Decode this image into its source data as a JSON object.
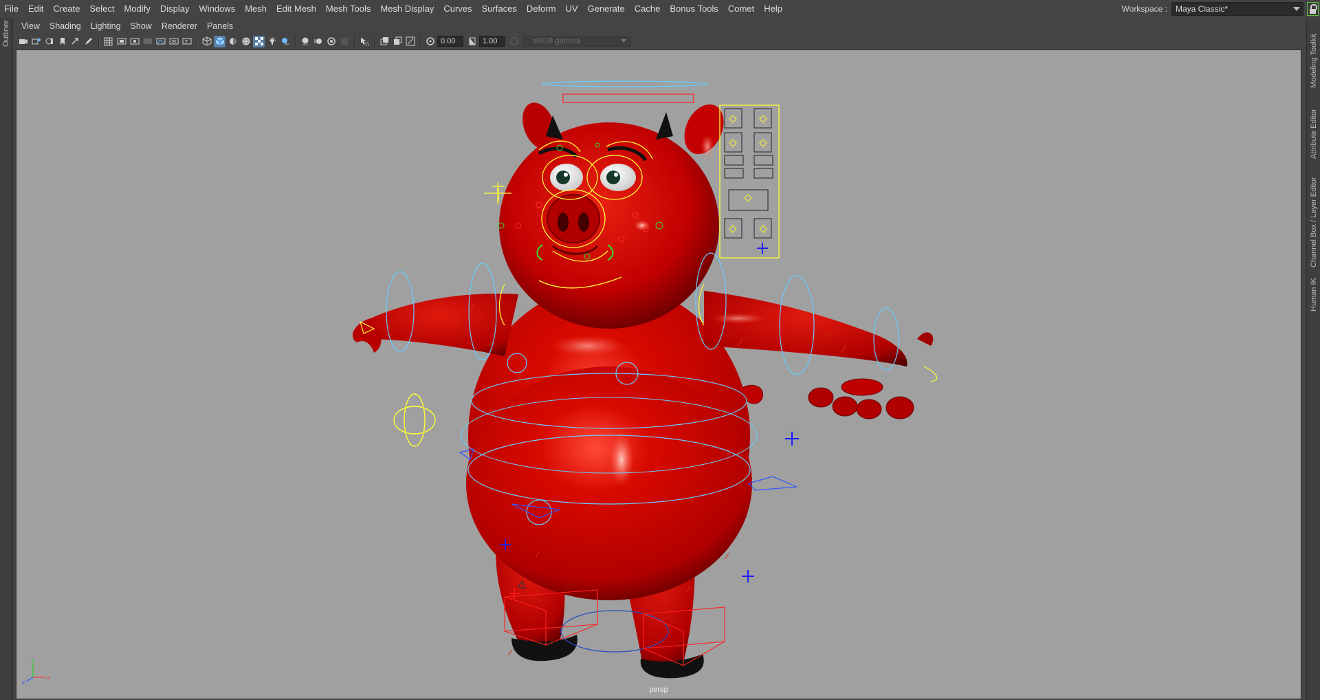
{
  "menubar": {
    "items": [
      "File",
      "Edit",
      "Create",
      "Select",
      "Modify",
      "Display",
      "Windows",
      "Mesh",
      "Edit Mesh",
      "Mesh Tools",
      "Mesh Display",
      "Curves",
      "Surfaces",
      "Deform",
      "UV",
      "Generate",
      "Cache",
      "Bonus Tools",
      "Comet",
      "Help"
    ],
    "workspace_label": "Workspace :",
    "workspace_value": "Maya Classic*"
  },
  "left_strip": {
    "outliner_label": "Outliner"
  },
  "right_strip": {
    "tabs": [
      "Modeling Toolkit",
      "Attribute Editor",
      "Channel Box / Layer Editor",
      "Human IK"
    ]
  },
  "panel": {
    "menu": [
      "View",
      "Shading",
      "Lighting",
      "Show",
      "Renderer",
      "Panels"
    ],
    "toolbar": {
      "exposure": "0.00",
      "gamma": "1.00",
      "colorspace": "sRGB gamma"
    },
    "camera_label": "persp"
  },
  "colors": {
    "ui_bg": "#444444",
    "viewport_bg": "#a0a0a0",
    "character_red": "#c40000",
    "control_yellow": "#ffff33",
    "control_cyan": "#66ccff",
    "control_blue": "#1e1eff",
    "accent_green": "#5fbf3a"
  }
}
